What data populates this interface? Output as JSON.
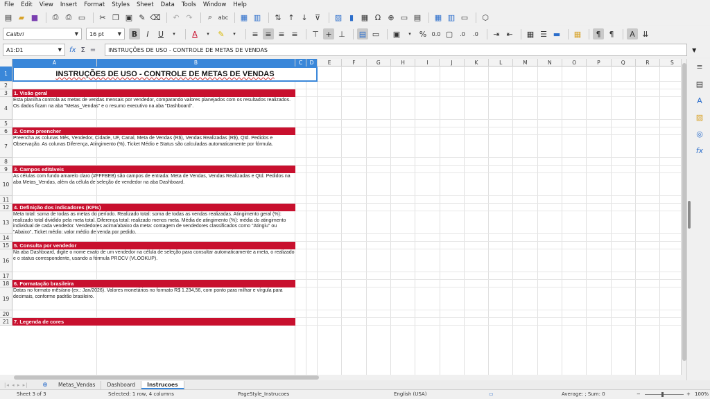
{
  "menu": [
    "File",
    "Edit",
    "View",
    "Insert",
    "Format",
    "Styles",
    "Sheet",
    "Data",
    "Tools",
    "Window",
    "Help"
  ],
  "toolbar2": {
    "font_name": "Calibri",
    "font_size": "16 pt"
  },
  "formula_bar": {
    "name_box": "A1:D1",
    "formula": "INSTRUÇÕES DE USO - CONTROLE DE METAS DE VENDAS",
    "fx": "fx",
    "sigma": "Σ",
    "equals": "="
  },
  "columns": [
    "A",
    "B",
    "C",
    "D",
    "E",
    "F",
    "G",
    "H",
    "I",
    "J",
    "K",
    "L",
    "M",
    "N",
    "O",
    "P",
    "Q",
    "R",
    "S"
  ],
  "rows": [
    "1",
    "2",
    "3",
    "4",
    "5",
    "6",
    "7",
    "8",
    "9",
    "10",
    "11",
    "12",
    "13",
    "14",
    "15",
    "16",
    "17",
    "18",
    "19",
    "20",
    "21"
  ],
  "sheet": {
    "title": "INSTRUÇÕES DE USO - CONTROLE DE METAS DE VENDAS",
    "sections": [
      {
        "heading": "1. Visão geral",
        "text": "Esta planilha controla as metas de vendas mensais por vendedor, comparando valores planejados com os resultados realizados. Os dados ficam na aba \"Metas_Vendas\" e o resumo executivo na aba \"Dashboard\"."
      },
      {
        "heading": "2. Como preencher",
        "text": "Preencha as colunas Mês, Vendedor, Cidade, UF, Canal, Meta de Vendas (R$), Vendas Realizadas (R$), Qtd. Pedidos e Observação. As colunas Diferença, Atingimento (%), Ticket Médio e Status são calculadas automaticamente por fórmula."
      },
      {
        "heading": "3. Campos editáveis",
        "text": "As células com fundo amarelo claro (#FFFBEB) são campos de entrada: Meta de Vendas, Vendas Realizadas e Qtd. Pedidos na aba Metas_Vendas, além da célula de seleção de vendedor na aba Dashboard."
      },
      {
        "heading": "4. Definição dos indicadores (KPIs)",
        "text": "Meta total: soma de todas as metas do período. Realizado total: soma de todas as vendas realizadas. Atingimento geral (%): realizado total dividido pela meta total. Diferença total: realizado menos meta. Média de atingimento (%): média do atingimento individual de cada vendedor. Vendedores acima/abaixo da meta: contagem de vendedores classificados como \"Atingiu\" ou \"Abaixo\". Ticket médio: valor médio de venda por pedido."
      },
      {
        "heading": "5. Consulta por vendedor",
        "text": "Na aba Dashboard, digite o nome exato de um vendedor na célula de seleção para consultar automaticamente a meta, o realizado e o status correspondente, usando a fórmula PROCV (VLOOKUP)."
      },
      {
        "heading": "6. Formatação brasileira",
        "text": "Datas no formato mês/ano (ex.: Jan/2026). Valores monetários no formato R$ 1.234,56, com ponto para milhar e vírgula para decimais, conforme padrão brasileiro."
      },
      {
        "heading": "7. Legenda de cores",
        "text": ""
      }
    ]
  },
  "tabs": [
    "Metas_Vendas",
    "Dashboard",
    "Instrucoes"
  ],
  "active_tab": "Instrucoes",
  "tab_add": "⊕",
  "status": {
    "sheet": "Sheet 3 of 3",
    "selection": "Selected: 1 row, 4 columns",
    "page_style": "PageStyle_Instrucoes",
    "language": "English (USA)",
    "sum": "Average: ; Sum: 0",
    "zoom": "100%"
  },
  "colors": {
    "section_header": "#c8102e",
    "selection": "#3a87d9"
  }
}
